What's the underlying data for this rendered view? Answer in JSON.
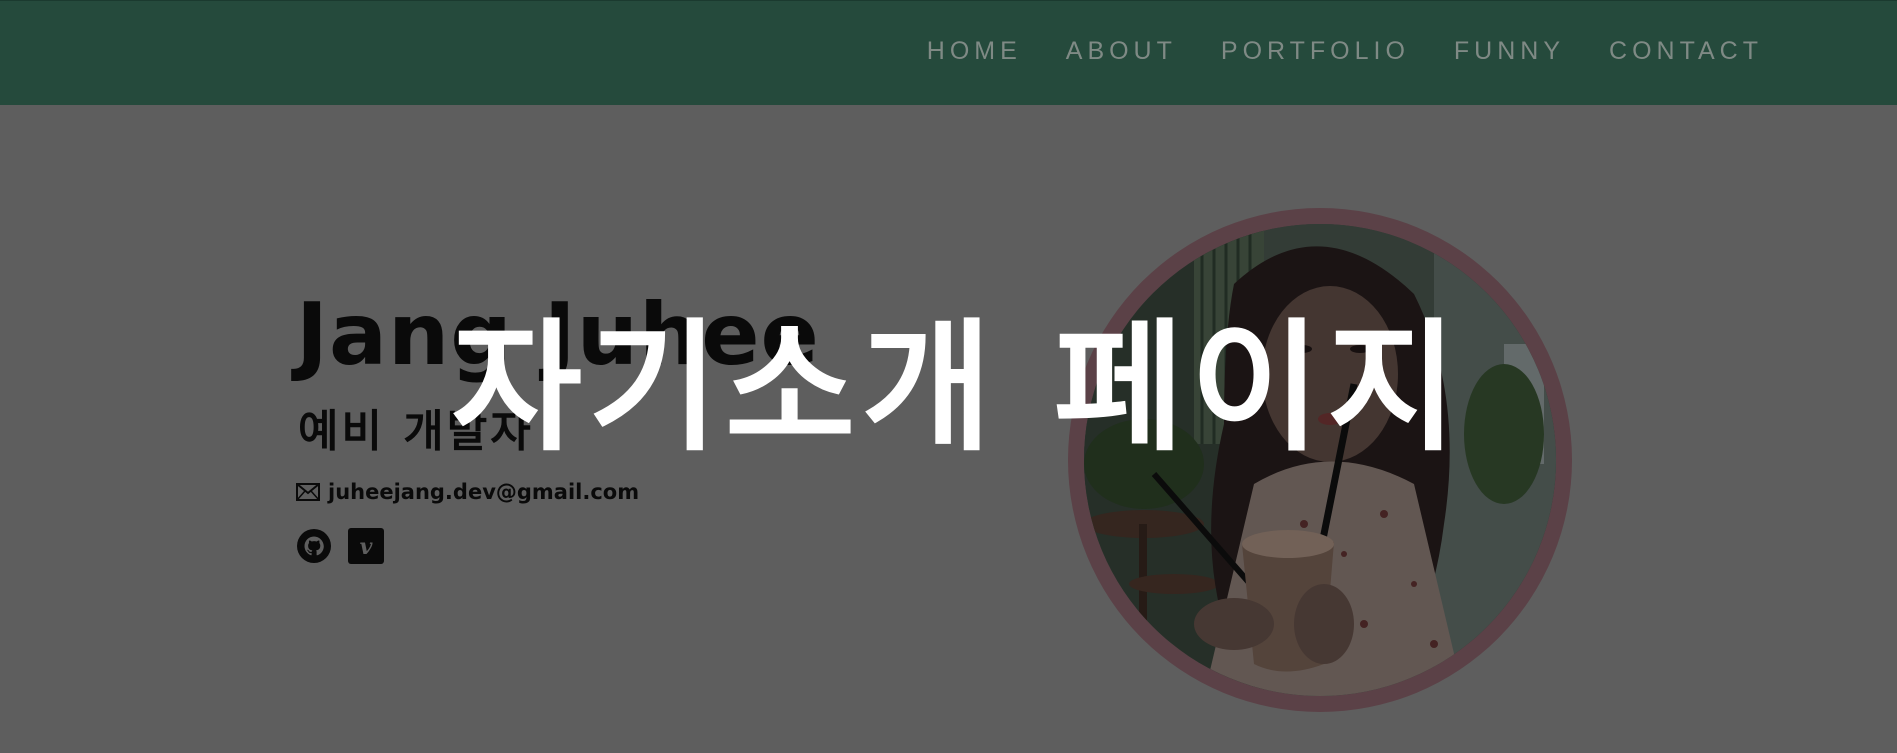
{
  "nav": {
    "items": [
      {
        "label": "HOME"
      },
      {
        "label": "ABOUT"
      },
      {
        "label": "PORTFOLIO"
      },
      {
        "label": "FUNNY"
      },
      {
        "label": "CONTACT"
      }
    ]
  },
  "hero": {
    "name": "Jang Juhee",
    "role": "예비 개발자",
    "email": "juheejang.dev@gmail.com",
    "social": [
      {
        "icon": "github-icon"
      },
      {
        "icon": "vimeo-icon"
      }
    ]
  },
  "overlay": {
    "title": "자기소개 페이지"
  },
  "colors": {
    "nav_bg": "#254a3c",
    "nav_text": "#7f8a85",
    "page_bg": "#5e5e5e",
    "photo_ring": "#5b4147",
    "overlay_text": "#ffffff"
  }
}
